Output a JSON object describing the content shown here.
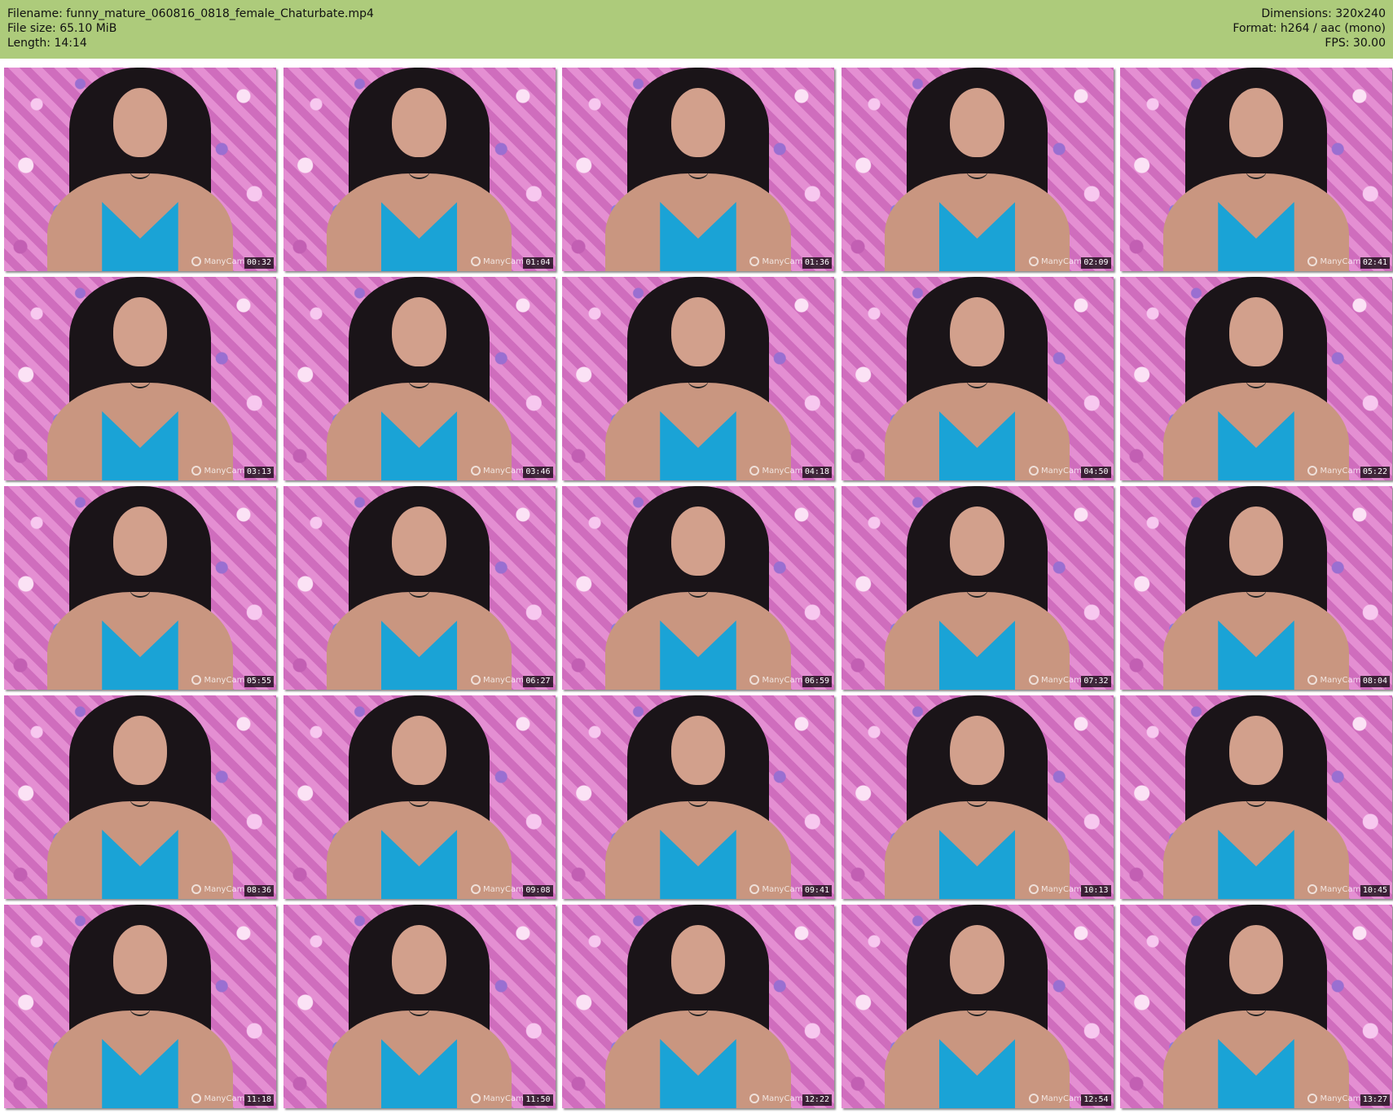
{
  "header": {
    "filename": "Filename: funny_mature_060816_0818_female_Chaturbate.mp4",
    "filesize": "File size: 65.10 MiB",
    "length": "Length: 14:14",
    "dimensions": "Dimensions: 320x240",
    "format": "Format: h264 / aac (mono)",
    "fps": "FPS: 30.00"
  },
  "colors": {
    "header_bg": "#adcb7b",
    "accent_top": "#1aa3d6",
    "background_pink": "#d77cc4"
  },
  "watermark": "ManyCam",
  "icons": {
    "watermark": "manycam-logo-icon"
  },
  "thumbnails": [
    {
      "time": "00:32"
    },
    {
      "time": "01:04"
    },
    {
      "time": "01:36"
    },
    {
      "time": "02:09"
    },
    {
      "time": "02:41"
    },
    {
      "time": "03:13"
    },
    {
      "time": "03:46"
    },
    {
      "time": "04:18"
    },
    {
      "time": "04:50"
    },
    {
      "time": "05:22"
    },
    {
      "time": "05:55"
    },
    {
      "time": "06:27"
    },
    {
      "time": "06:59"
    },
    {
      "time": "07:32"
    },
    {
      "time": "08:04"
    },
    {
      "time": "08:36"
    },
    {
      "time": "09:08"
    },
    {
      "time": "09:41"
    },
    {
      "time": "10:13"
    },
    {
      "time": "10:45"
    },
    {
      "time": "11:18"
    },
    {
      "time": "11:50"
    },
    {
      "time": "12:22"
    },
    {
      "time": "12:54"
    },
    {
      "time": "13:27"
    }
  ]
}
